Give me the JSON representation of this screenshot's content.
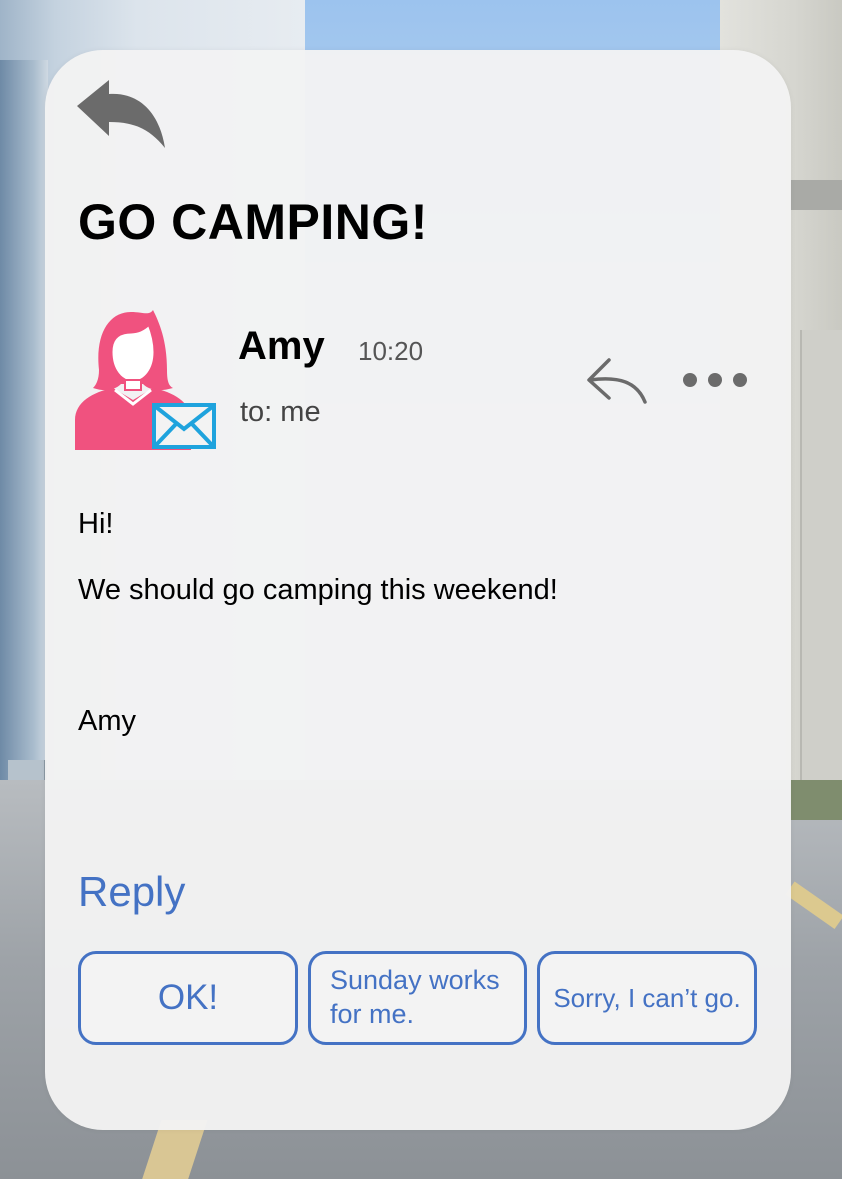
{
  "email": {
    "subject": "GO CAMPING!",
    "sender": "Amy",
    "time": "10:20",
    "recipient": "to: me",
    "body": {
      "greeting": "Hi!",
      "message": "We should go camping this weekend!",
      "signature": "Amy"
    }
  },
  "reply": {
    "heading": "Reply",
    "options": [
      "OK!",
      "Sunday works for me.",
      "Sorry, I can’t go."
    ]
  },
  "icons": {
    "back": "back-arrow-icon",
    "avatar": "woman-avatar-icon",
    "mail_badge": "envelope-icon",
    "reply": "reply-arrow-icon",
    "more": "more-options-icon"
  },
  "colors": {
    "accent": "#4472c4",
    "avatar": "#f0527f",
    "envelope": "#1fa3dd",
    "icon_gray": "#6b6b6b",
    "card": "#f3f3f3"
  }
}
